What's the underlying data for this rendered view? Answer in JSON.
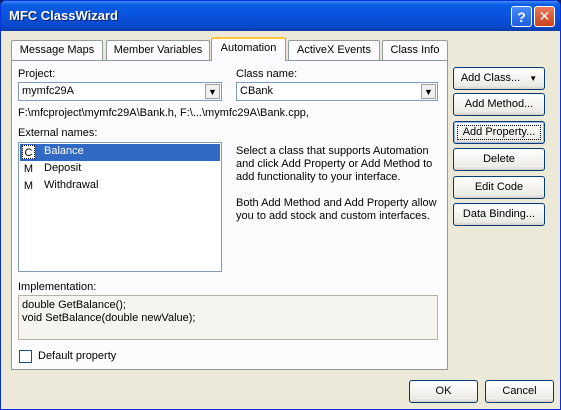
{
  "window": {
    "title": "MFC ClassWizard",
    "help_glyph": "?",
    "close_glyph": "✕"
  },
  "tabs": [
    {
      "label": "Message Maps",
      "active": false
    },
    {
      "label": "Member Variables",
      "active": false
    },
    {
      "label": "Automation",
      "active": true
    },
    {
      "label": "ActiveX Events",
      "active": false
    },
    {
      "label": "Class Info",
      "active": false
    }
  ],
  "project": {
    "label": "Project:",
    "value": "mymfc29A"
  },
  "class_name": {
    "label": "Class name:",
    "value": "CBank"
  },
  "file_path": "F:\\mfcproject\\mymfc29A\\Bank.h, F:\\...\\mymfc29A\\Bank.cpp,",
  "external_names": {
    "label": "External names:",
    "items": [
      {
        "code": "C",
        "name": "Balance",
        "selected": true
      },
      {
        "code": "M",
        "name": "Deposit",
        "selected": false
      },
      {
        "code": "M",
        "name": "Withdrawal",
        "selected": false
      }
    ]
  },
  "info": {
    "line1": "Select a class that supports Automation",
    "line2": "and click Add Property or Add Method to",
    "line3": "add functionality to your interface.",
    "line4": "Both Add Method and Add Property allow",
    "line5": "you to add stock and custom interfaces."
  },
  "implementation": {
    "label": "Implementation:",
    "lines": [
      "double GetBalance();",
      "void SetBalance(double newValue);"
    ]
  },
  "default_property": {
    "label": "Default property",
    "checked": false
  },
  "buttons": {
    "add_class": "Add Class...",
    "add_method": "Add Method...",
    "add_property": "Add Property...",
    "delete": "Delete",
    "edit_code": "Edit Code",
    "data_binding": "Data Binding...",
    "ok": "OK",
    "cancel": "Cancel"
  },
  "dropdown_glyph": "▼"
}
